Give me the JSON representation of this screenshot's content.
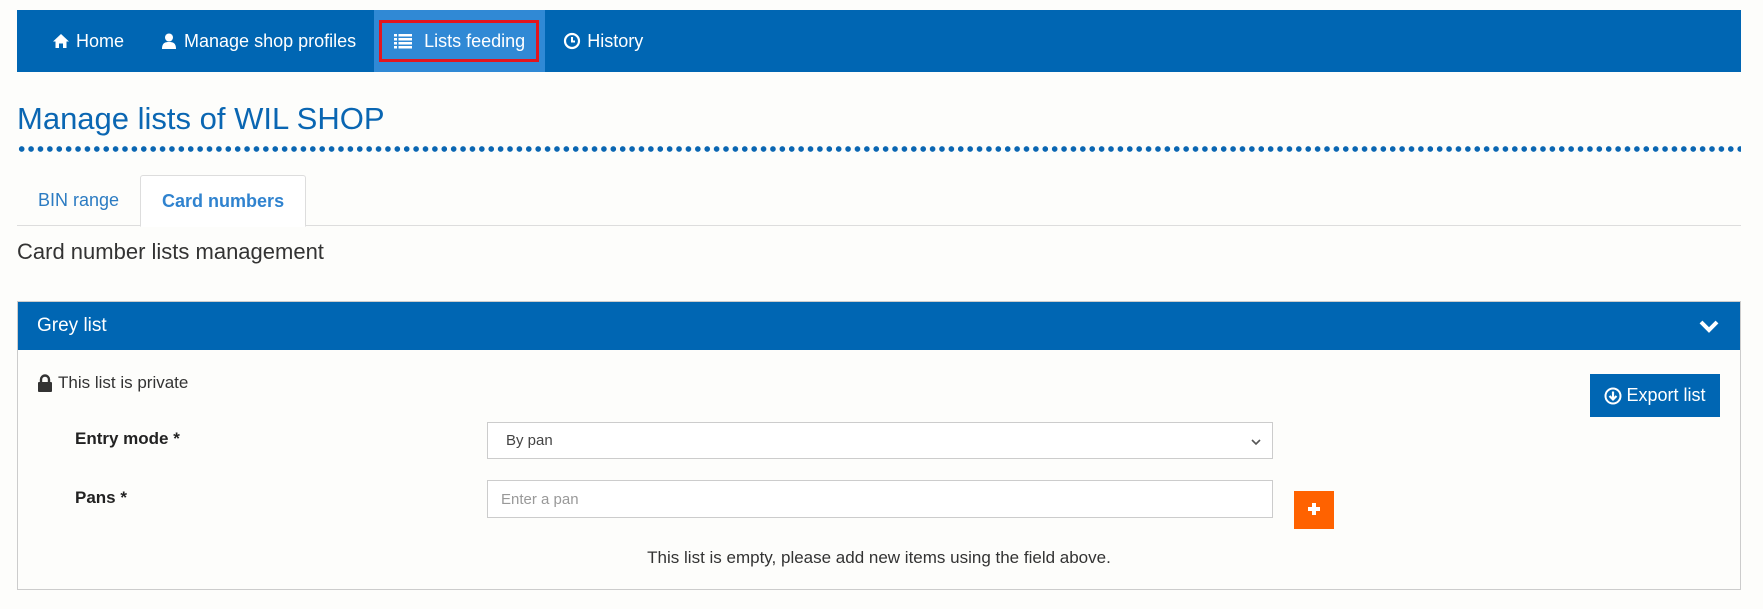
{
  "nav": {
    "items": [
      {
        "label": "Home",
        "icon": "home-icon"
      },
      {
        "label": "Manage shop profiles",
        "icon": "user-icon"
      },
      {
        "label": "Lists feeding",
        "icon": "list-icon",
        "active": true
      },
      {
        "label": "History",
        "icon": "clock-icon"
      }
    ]
  },
  "page": {
    "title": "Manage lists of WIL SHOP",
    "subtitle": "Card number lists management"
  },
  "tabs": [
    {
      "label": "BIN range"
    },
    {
      "label": "Card numbers",
      "active": true
    }
  ],
  "panel": {
    "title": "Grey list",
    "privacy_text": "This list is private",
    "export_label": "Export list",
    "entry_mode_label": "Entry mode *",
    "entry_mode_value": "By pan",
    "pans_label": "Pans *",
    "pans_placeholder": "Enter a pan",
    "pans_value": "",
    "empty_message": "This list is empty, please add new items using the field above."
  },
  "colors": {
    "primary": "#0066b3",
    "active_nav": "#3089d5",
    "highlight": "#e3151d",
    "add_button": "#ff6200"
  }
}
